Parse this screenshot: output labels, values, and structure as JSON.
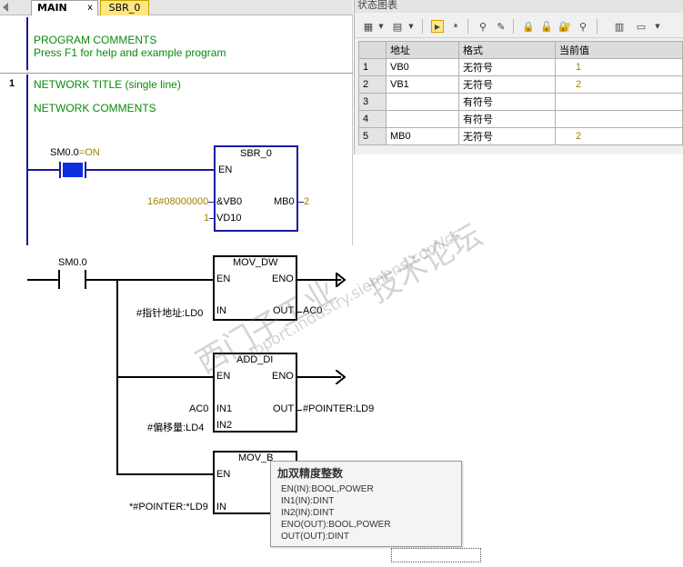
{
  "editor": {
    "tabs": [
      {
        "label": "MAIN",
        "close": "x"
      },
      {
        "label": "SBR_0"
      }
    ],
    "program_comments": "PROGRAM COMMENTS",
    "program_help": "Press F1 for help and example program",
    "network_number": "1",
    "network_title": "NETWORK TITLE (single line)",
    "network_comments": "NETWORK COMMENTS",
    "contact_label": "SM0.0",
    "contact_state": "=ON",
    "block": {
      "name": "SBR_0",
      "en": "EN",
      "in1_label": "&VB0",
      "in1_value": "16#08000000",
      "in2_label": "VD10",
      "in2_value": "1",
      "out_label": "MB0",
      "out_value": "2"
    }
  },
  "status_chart": {
    "title": "状态图表",
    "columns": [
      "地址",
      "格式",
      "当前值"
    ],
    "rows": [
      {
        "n": "1",
        "address": "VB0",
        "format": "无符号",
        "value": "1"
      },
      {
        "n": "2",
        "address": "VB1",
        "format": "无符号",
        "value": "2"
      },
      {
        "n": "3",
        "address": "",
        "format": "有符号",
        "value": ""
      },
      {
        "n": "4",
        "address": "",
        "format": "有符号",
        "value": ""
      },
      {
        "n": "5",
        "address": "MB0",
        "format": "无符号",
        "value": "2"
      }
    ]
  },
  "ladder": {
    "contact": "SM0.0",
    "mov_dw": {
      "name": "MOV_DW",
      "en": "EN",
      "eno": "ENO",
      "in": "IN",
      "out": "OUT",
      "in_operand": "#指针地址:LD0",
      "out_operand": "AC0"
    },
    "add_di": {
      "name": "ADD_DI",
      "en": "EN",
      "eno": "ENO",
      "in1": "IN1",
      "in2": "IN2",
      "out": "OUT",
      "in1_operand": "AC0",
      "in2_operand": "#偏移量:LD4",
      "out_operand": "#POINTER:LD9"
    },
    "mov_b": {
      "name": "MOV_B",
      "en": "EN",
      "in": "IN",
      "in_operand": "*#POINTER:*LD9"
    }
  },
  "tooltip": {
    "title": "加双精度整数",
    "lines": [
      "EN(IN):BOOL,POWER",
      "IN1(IN):DINT",
      "IN2(IN):DINT",
      "ENO(OUT):BOOL,POWER",
      "OUT(OUT):DINT"
    ]
  },
  "watermark": {
    "text1": "西门子工业",
    "text2": "support.industry.siemens.com/cs",
    "text3": "技术论坛"
  }
}
